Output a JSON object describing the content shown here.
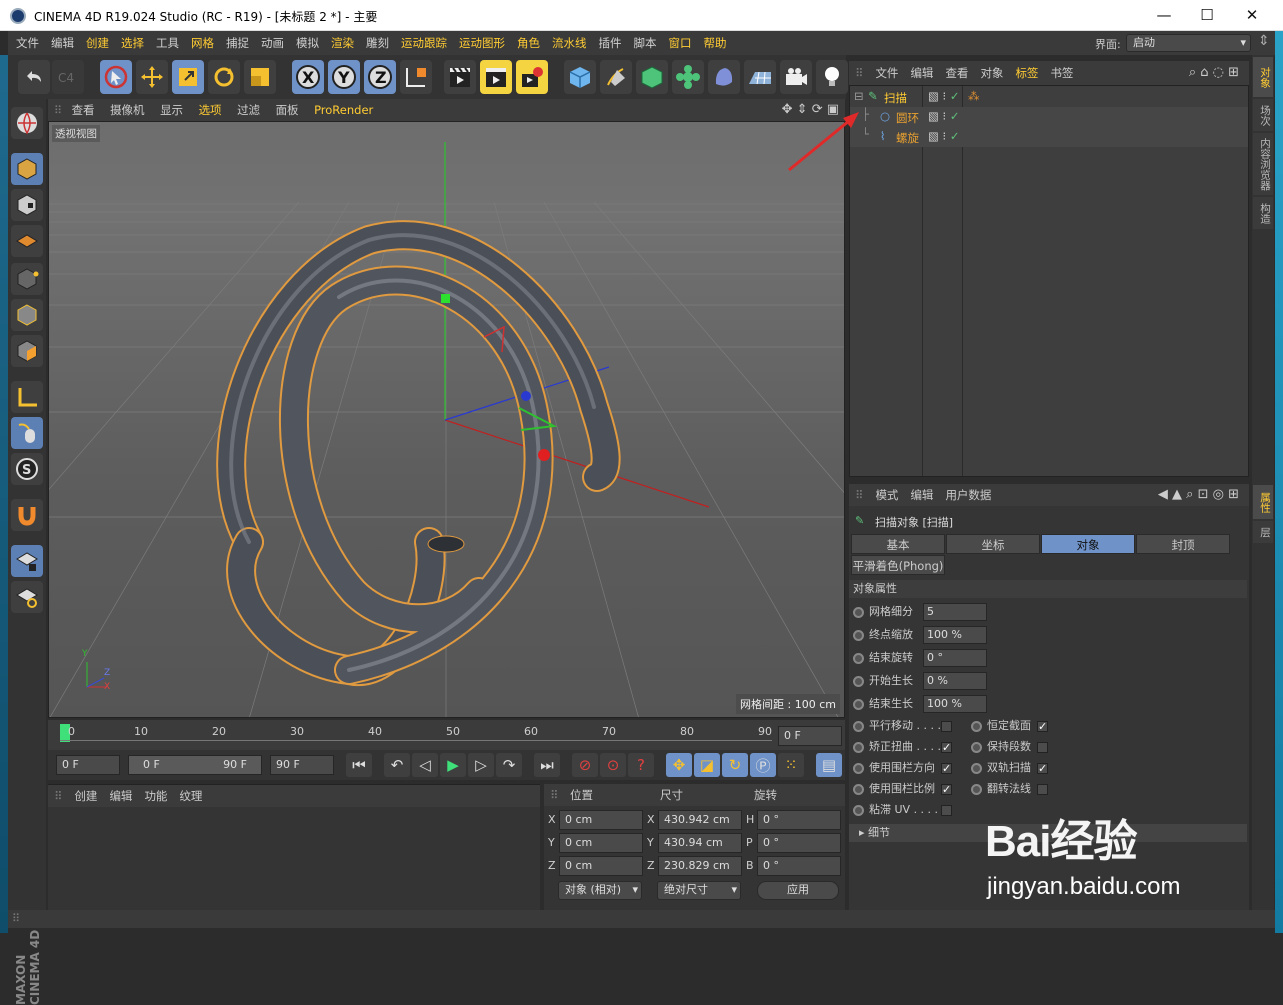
{
  "window": {
    "title": "CINEMA 4D R19.024 Studio (RC - R19) - [未标题 2 *] - 主要",
    "minimize": "—",
    "maximize": "☐",
    "close": "✕"
  },
  "menu": {
    "items": [
      "文件",
      "编辑",
      "创建",
      "选择",
      "工具",
      "网格",
      "捕捉",
      "动画",
      "模拟",
      "渲染",
      "雕刻",
      "运动跟踪",
      "运动图形",
      "角色",
      "流水线",
      "插件",
      "脚本",
      "窗口",
      "帮助"
    ],
    "layout_label": "界面:",
    "layout_value": "启动"
  },
  "viewport": {
    "menu": [
      "查看",
      "摄像机",
      "显示",
      "选项",
      "过滤",
      "面板",
      "ProRender"
    ],
    "highlighted_menu": "选项",
    "label": "透视视图",
    "grid_info": "网格间距 : 100 cm",
    "axis": {
      "y": "Y",
      "z": "Z",
      "x": "X"
    }
  },
  "timeline": {
    "ticks": [
      "0",
      "10",
      "20",
      "30",
      "40",
      "50",
      "60",
      "70",
      "80",
      "90"
    ],
    "current_frame": "0 F",
    "start": "0 F",
    "range_start": "0 F",
    "range_end": "90 F",
    "end": "90 F"
  },
  "material_panel": {
    "menu": [
      "创建",
      "编辑",
      "功能",
      "纹理"
    ]
  },
  "coord_panel": {
    "headers": [
      "位置",
      "尺寸",
      "旋转"
    ],
    "rows": [
      {
        "axis": "X",
        "pos": "0 cm",
        "size_axis": "X",
        "size": "430.942 cm",
        "rot_axis": "H",
        "rot": "0 °"
      },
      {
        "axis": "Y",
        "pos": "0 cm",
        "size_axis": "Y",
        "size": "430.94 cm",
        "rot_axis": "P",
        "rot": "0 °"
      },
      {
        "axis": "Z",
        "pos": "0 cm",
        "size_axis": "Z",
        "size": "230.829 cm",
        "rot_axis": "B",
        "rot": "0 °"
      }
    ],
    "mode": "对象 (相对)",
    "size_mode": "绝对尺寸",
    "apply": "应用"
  },
  "object_manager": {
    "menu": [
      "文件",
      "编辑",
      "查看",
      "对象",
      "标签",
      "书签"
    ],
    "highlighted_menu": "标签",
    "objects": [
      {
        "name": "扫描",
        "color": "#ffcc33"
      },
      {
        "name": "圆环",
        "color": "#e8a030"
      },
      {
        "name": "螺旋",
        "color": "#e8a030"
      }
    ]
  },
  "attribute_manager": {
    "menu": [
      "模式",
      "编辑",
      "用户数据"
    ],
    "object_title": "扫描对象 [扫描]",
    "tabs": [
      "基本",
      "坐标",
      "对象",
      "封顶"
    ],
    "selected_tab": "对象",
    "extra_tab": "平滑着色(Phong)",
    "section": "对象属性",
    "fields": [
      {
        "label": "网格细分",
        "value": "5"
      },
      {
        "label": "终点缩放",
        "value": "100 %"
      },
      {
        "label": "结束旋转",
        "value": "0 °"
      },
      {
        "label": "开始生长",
        "value": "0 %"
      },
      {
        "label": "结束生长",
        "value": "100 %"
      }
    ],
    "checks_left": [
      {
        "label": "平行移动 . . . .",
        "checked": false
      },
      {
        "label": "矫正扭曲 . . . .",
        "checked": true
      },
      {
        "label": "使用围栏方向",
        "checked": true
      },
      {
        "label": "使用围栏比例",
        "checked": true
      },
      {
        "label": "粘滞 UV . . . .",
        "checked": false
      }
    ],
    "checks_right": [
      {
        "label": "恒定截面",
        "checked": true
      },
      {
        "label": "保持段数",
        "checked": false
      },
      {
        "label": "双轨扫描",
        "checked": true
      },
      {
        "label": "翻转法线",
        "checked": false
      }
    ],
    "details": "细节"
  },
  "right_tabs": [
    "对象",
    "场次",
    "内容浏览器",
    "构造"
  ],
  "right_tabs_lower": [
    "属性",
    "层"
  ],
  "brand": "MAXON CINEMA 4D",
  "watermark": {
    "main": "Bai经验",
    "url": "jingyan.baidu.com"
  }
}
